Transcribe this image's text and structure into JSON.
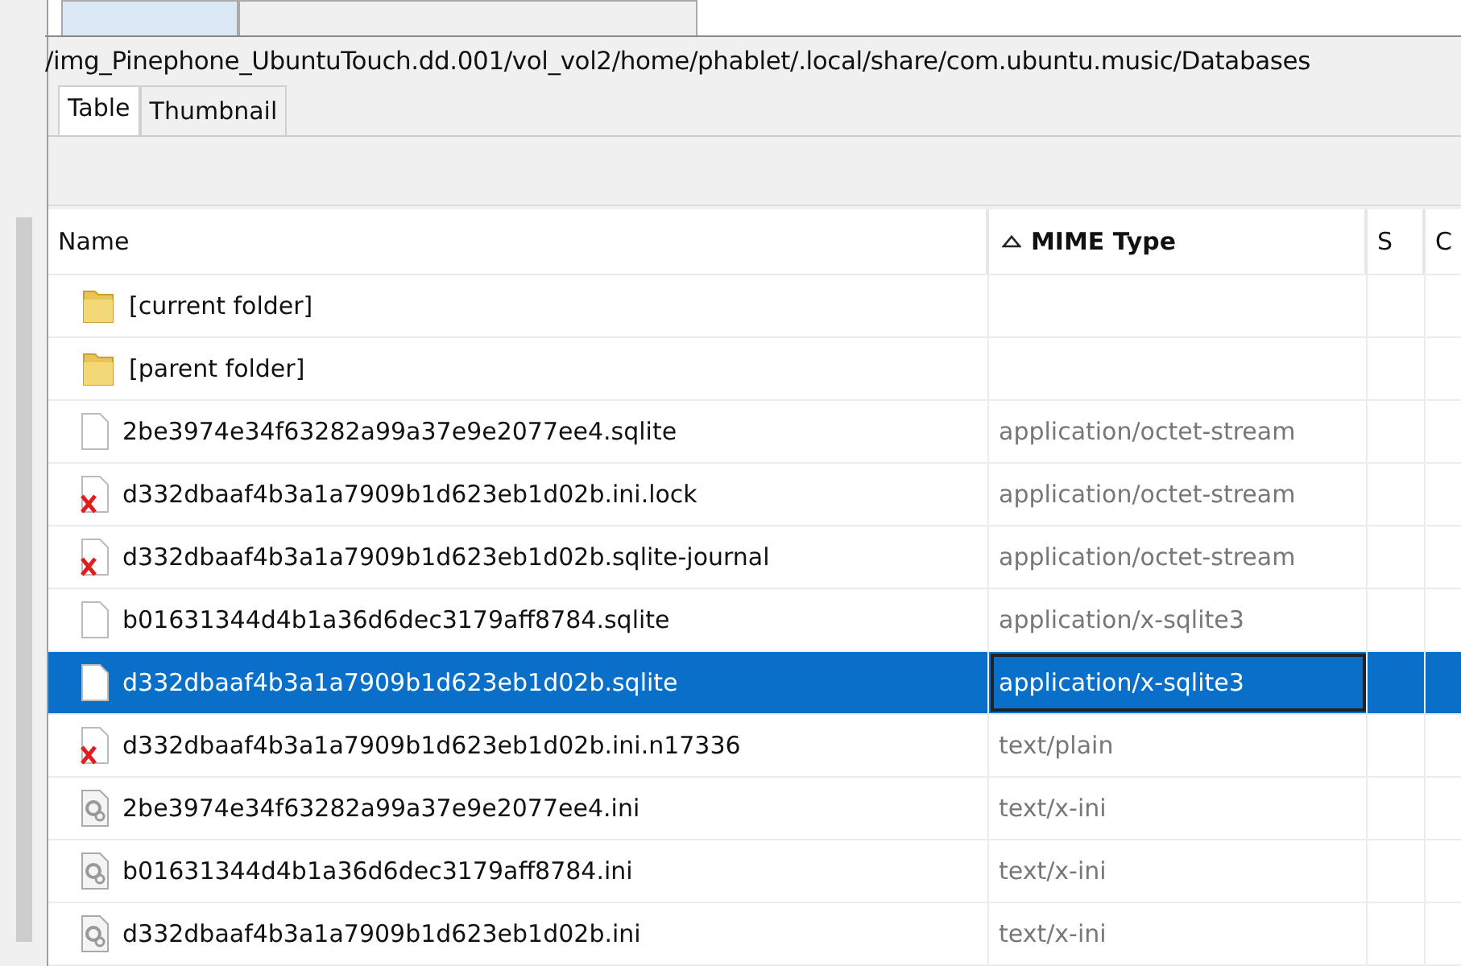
{
  "document_tabs": [
    {
      "selected": true
    },
    {
      "selected": false
    }
  ],
  "path": "/img_Pinephone_UbuntuTouch.dd.001/vol_vol2/home/phablet/.local/share/com.ubuntu.music/Databases",
  "view_tabs": [
    {
      "label": "Table",
      "selected": true
    },
    {
      "label": "Thumbnail",
      "selected": false
    }
  ],
  "table": {
    "columns": [
      {
        "label": "Name",
        "sorted": false
      },
      {
        "label": "MIME Type",
        "sorted": true
      },
      {
        "label": "S",
        "sorted": false
      },
      {
        "label": "C",
        "sorted": false
      }
    ],
    "rows": [
      {
        "kind": "folder",
        "name": "[current folder]",
        "selected": false
      },
      {
        "kind": "folder",
        "name": "[parent folder]",
        "selected": false
      },
      {
        "kind": "file",
        "name": "2be3974e34f63282a99a37e9e2077ee4.sqlite",
        "mime_type": "application/octet-stream",
        "selected": false
      },
      {
        "kind": "deleted",
        "name": "d332dbaaf4b3a1a7909b1d623eb1d02b.ini.lock",
        "mime_type": "application/octet-stream",
        "selected": false
      },
      {
        "kind": "deleted",
        "name": "d332dbaaf4b3a1a7909b1d623eb1d02b.sqlite-journal",
        "mime_type": "application/octet-stream",
        "selected": false
      },
      {
        "kind": "file",
        "name": "b01631344d4b1a36d6dec3179aff8784.sqlite",
        "mime_type": "application/x-sqlite3",
        "selected": false
      },
      {
        "kind": "file",
        "name": "d332dbaaf4b3a1a7909b1d623eb1d02b.sqlite",
        "mime_type": "application/x-sqlite3",
        "selected": true
      },
      {
        "kind": "deleted",
        "name": "d332dbaaf4b3a1a7909b1d623eb1d02b.ini.n17336",
        "mime_type": "text/plain",
        "selected": false
      },
      {
        "kind": "settings",
        "name": "2be3974e34f63282a99a37e9e2077ee4.ini",
        "mime_type": "text/x-ini",
        "selected": false
      },
      {
        "kind": "settings",
        "name": "b01631344d4b1a36d6dec3179aff8784.ini",
        "mime_type": "text/x-ini",
        "selected": false
      },
      {
        "kind": "settings",
        "name": "d332dbaaf4b3a1a7909b1d623eb1d02b.ini",
        "mime_type": "text/x-ini",
        "selected": false
      }
    ]
  }
}
